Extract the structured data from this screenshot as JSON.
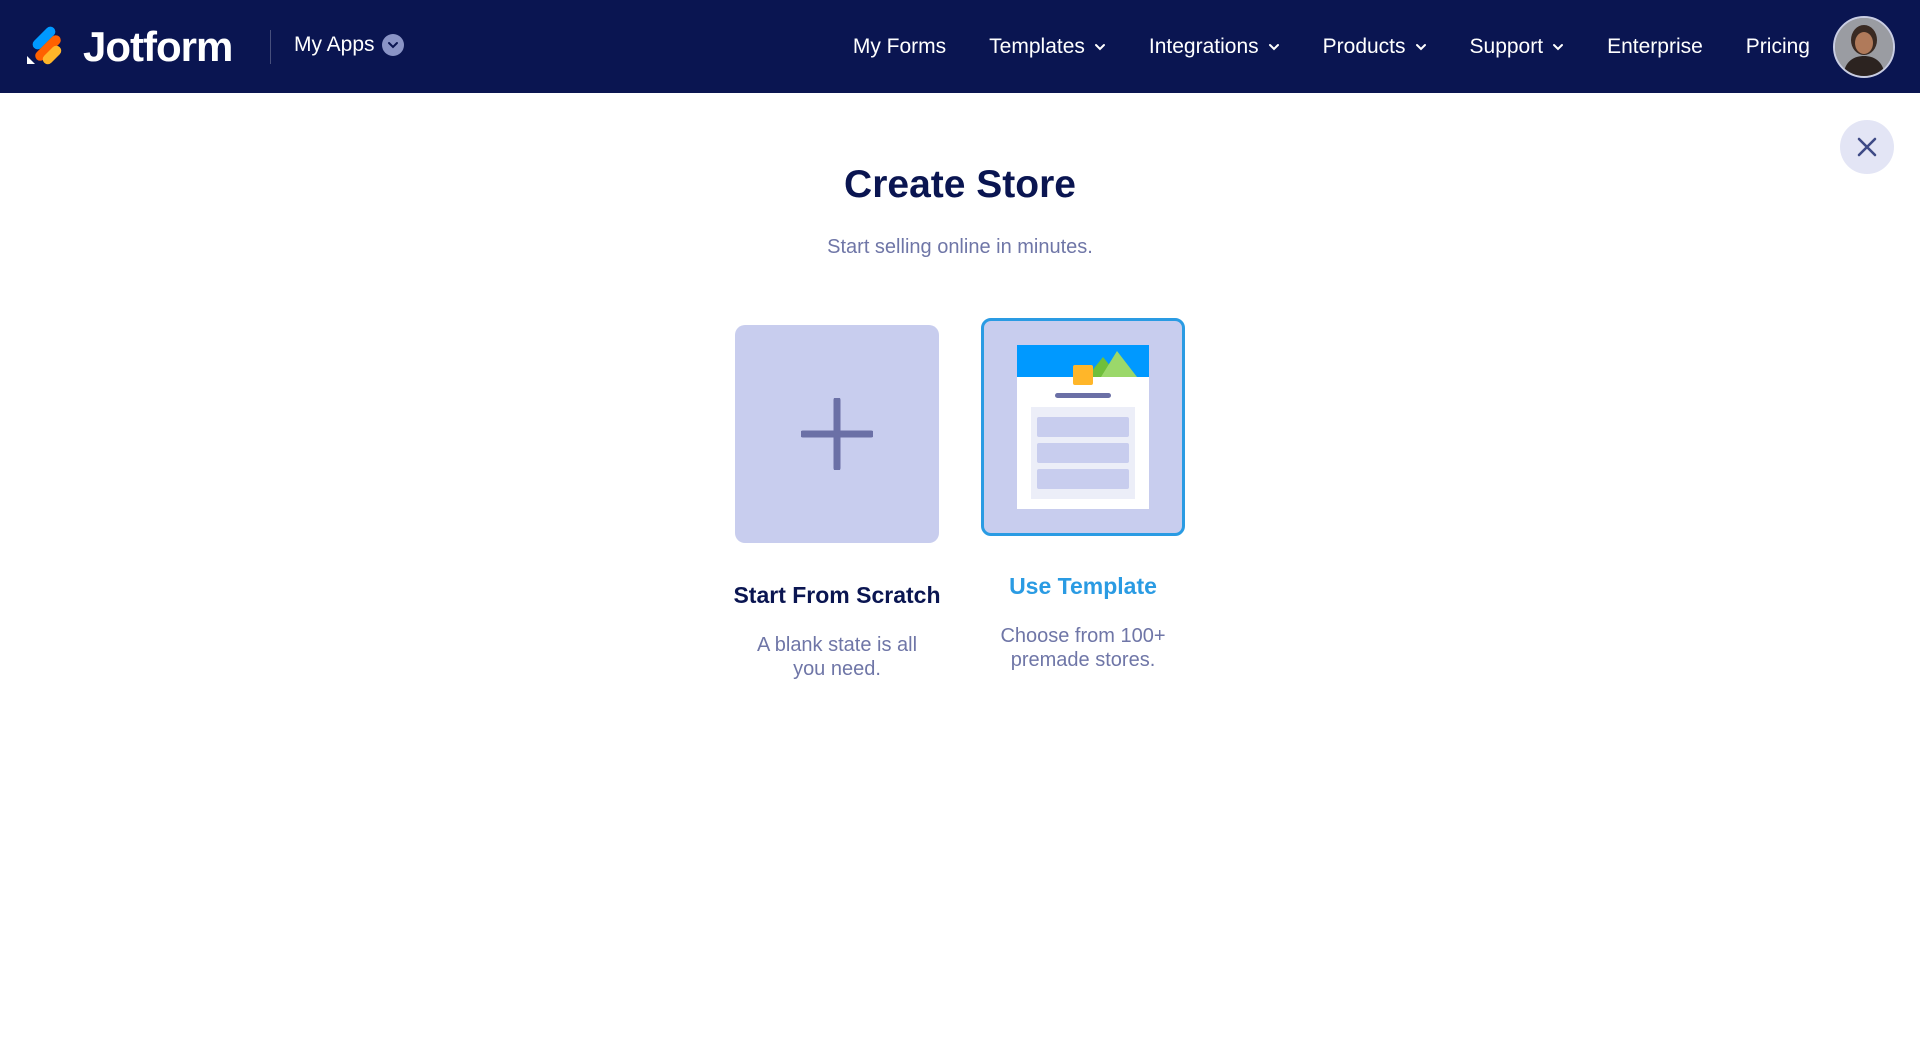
{
  "header": {
    "brand": "Jotform",
    "my_apps": "My Apps",
    "nav": [
      {
        "label": "My Forms",
        "has_dropdown": false
      },
      {
        "label": "Templates",
        "has_dropdown": true
      },
      {
        "label": "Integrations",
        "has_dropdown": true
      },
      {
        "label": "Products",
        "has_dropdown": true
      },
      {
        "label": "Support",
        "has_dropdown": true
      },
      {
        "label": "Enterprise",
        "has_dropdown": false
      },
      {
        "label": "Pricing",
        "has_dropdown": false
      }
    ]
  },
  "main": {
    "title": "Create Store",
    "subtitle": "Start selling online in minutes.",
    "options": [
      {
        "label": "Start From Scratch",
        "description": "A blank state is all you need.",
        "icon": "plus-icon"
      },
      {
        "label": "Use Template",
        "description": "Choose from 100+ premade stores.",
        "icon": "store-template-icon",
        "selected": true
      }
    ]
  },
  "colors": {
    "header_bg": "#0a1551",
    "card_bg": "#c8cdee",
    "accent": "#2a9be3",
    "muted_text": "#6f76a7",
    "logo_blue": "#0099ff",
    "logo_orange": "#ff6100",
    "logo_yellow": "#ffb629"
  }
}
